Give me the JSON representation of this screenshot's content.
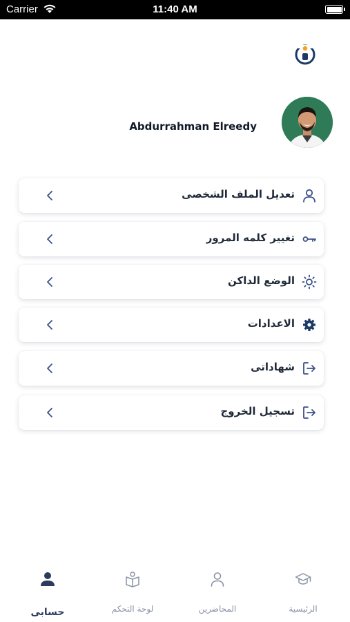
{
  "status_bar": {
    "carrier": "Carrier",
    "time": "11:40 AM"
  },
  "profile": {
    "name": "Abdurrahman Elreedy"
  },
  "menu": {
    "items": [
      {
        "label": "تعديل الملف الشخصى",
        "icon": "user-icon"
      },
      {
        "label": "تغيير كلمه المرور",
        "icon": "key-icon"
      },
      {
        "label": "الوضع الداكن",
        "icon": "sun-icon"
      },
      {
        "label": "الاعدادات",
        "icon": "gear-icon"
      },
      {
        "label": "شهاداتى",
        "icon": "logout-icon"
      },
      {
        "label": "تسجيل الخروج",
        "icon": "logout-icon"
      }
    ]
  },
  "bottom_nav": {
    "items": [
      {
        "label": "حسابى",
        "icon": "user-icon",
        "active": true
      },
      {
        "label": "لوحة التحكم",
        "icon": "dashboard-book-icon",
        "active": false
      },
      {
        "label": "المحاضرين",
        "icon": "person-outline-icon",
        "active": false
      },
      {
        "label": "الرئيسية",
        "icon": "graduation-cap-icon",
        "active": false
      }
    ]
  },
  "colors": {
    "primary": "#2c3a5e",
    "icon_blue": "#3a4f8a",
    "inactive_nav": "#8a92a6",
    "avatar_bg": "#2f7a57",
    "logo_accent": "#f2a21b"
  }
}
